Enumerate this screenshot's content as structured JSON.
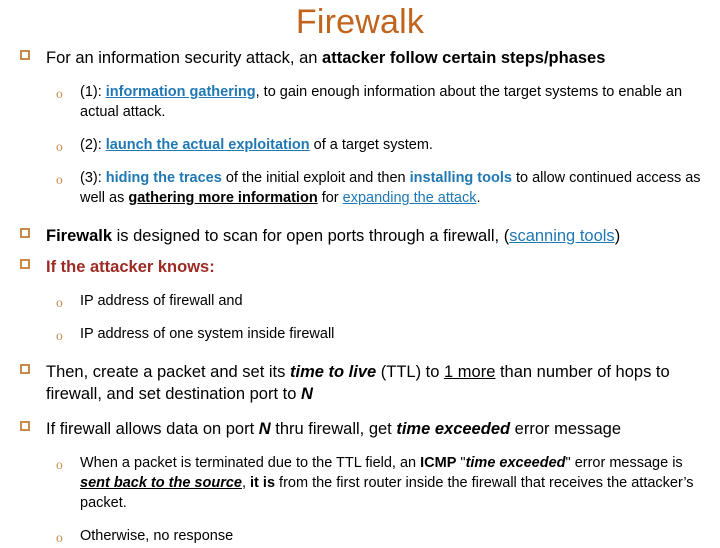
{
  "slide": {
    "title": "Firewalk",
    "title_color": "#C0641E",
    "accent_bullet_color": "#C98A4B",
    "link_color": "#1F78B4",
    "heading_color": "#9E2A24"
  },
  "bullets": {
    "b1": {
      "r1": "For an information security attack, an ",
      "r2": "attacker follow certain steps/phases"
    },
    "s1": {
      "r1": "(1): ",
      "r2": "information gathering",
      "r3": ", to gain enough information about the target systems to enable an actual attack."
    },
    "s2": {
      "r1": "(2): ",
      "r2": "launch the actual exploitation",
      "r3": " of a target system."
    },
    "s3": {
      "r1": "(3): ",
      "r2": "hiding the traces",
      "r3": " of the initial exploit and then ",
      "r4": "installing tools",
      "r5": " to allow continued access as well as ",
      "r6": "gathering more information",
      "r7": " for ",
      "r8": "expanding the attack",
      "r9": "."
    },
    "b2": {
      "r1": "Firewalk",
      "r2": " is designed to scan for open ports through a firewall, (",
      "r3": "scanning tools",
      "r4": ")"
    },
    "b3": {
      "r1": "If the attacker knows:"
    },
    "s4": {
      "r1": "IP address of firewall and"
    },
    "s5": {
      "r1": "IP address of one system inside firewall"
    },
    "b4": {
      "r1": "Then, create a packet and set its ",
      "r2": "time to live",
      "r3": " (TTL) to ",
      "r4": "1 more",
      "r5": " than number of hops to firewall, and set destination port to ",
      "r6": "N"
    },
    "b5": {
      "r1": "If firewall allows data on port ",
      "r2": "N",
      "r3": " thru firewall, get ",
      "r4": "time exceeded",
      "r5": " error message"
    },
    "s6": {
      "r1": "When a packet is terminated due to the TTL field, an ",
      "r2": "ICMP",
      "r3": " \"",
      "r4": "time exceeded",
      "r5": "\" error message is ",
      "r6": "sent back to the source",
      "r7": ", ",
      "r8": "it is",
      "r9": " from the first router inside the firewall that receives the attacker’s packet."
    },
    "s7": {
      "r1": "Otherwise, no response"
    }
  },
  "markers": {
    "level1": "❑",
    "level2": "o"
  }
}
